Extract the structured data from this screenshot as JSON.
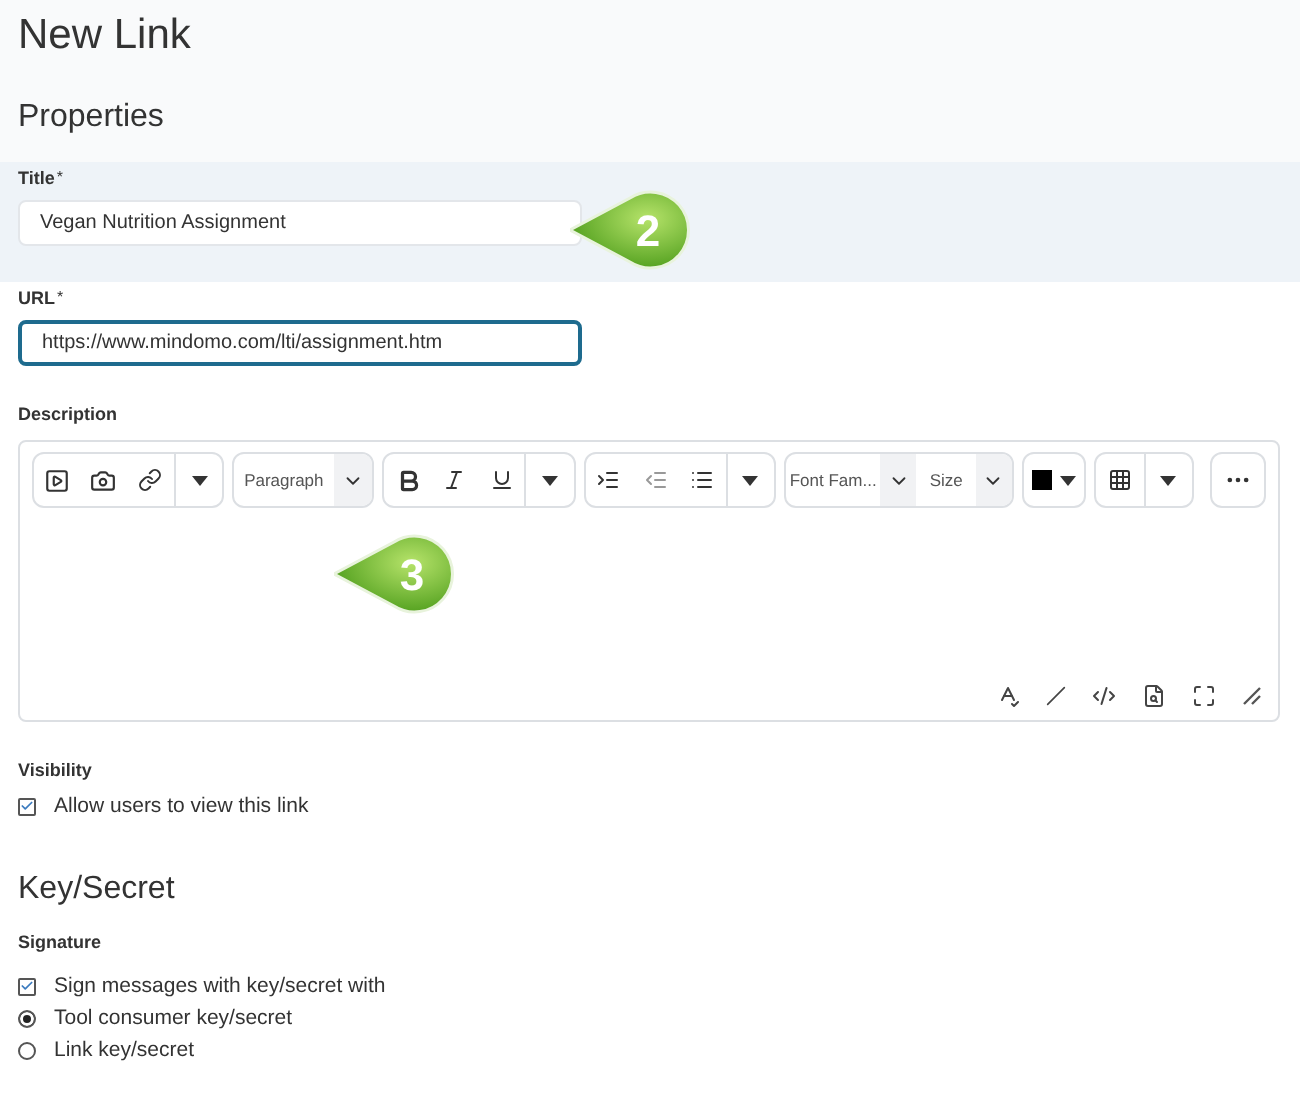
{
  "page_title": "New Link",
  "properties": {
    "heading": "Properties",
    "title_field": {
      "label": "Title",
      "required_mark": "*",
      "value": "Vegan Nutrition Assignment",
      "focused": false
    },
    "url_field": {
      "label": "URL",
      "required_mark": "*",
      "value": "https://www.mindomo.com/lti/assignment.htm",
      "focused": true
    },
    "description": {
      "label": "Description",
      "format_select": "Paragraph",
      "font_select": "Font Fam...",
      "size_select": "Size"
    },
    "visibility": {
      "label": "Visibility",
      "options": [
        {
          "kind": "checkbox",
          "label": "Allow users to view this link",
          "checked": true
        }
      ]
    }
  },
  "key_secret": {
    "heading": "Key/Secret",
    "signature": {
      "label": "Signature",
      "options": [
        {
          "kind": "checkbox",
          "label": "Sign messages with key/secret with",
          "checked": true
        },
        {
          "kind": "radio",
          "label": "Tool consumer key/secret",
          "selected": true
        },
        {
          "kind": "radio",
          "label": "Link key/secret",
          "selected": false
        }
      ]
    }
  },
  "callouts": [
    {
      "number": "2"
    },
    {
      "number": "3"
    }
  ]
}
